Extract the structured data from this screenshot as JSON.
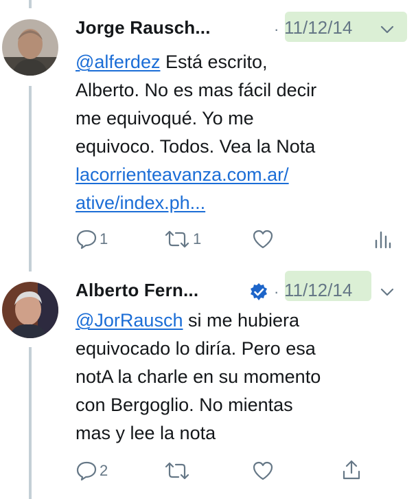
{
  "tweets": [
    {
      "author": "Jorge Rausch...",
      "separator": "·",
      "date": "11/12/14",
      "mention": "@alferdez",
      "text_lines": [
        "Está escrito,",
        "Alberto. No es mas fácil decir",
        "me equivoqué. Yo me",
        "equivoco. Todos. Vea la Nota"
      ],
      "link_lines": [
        "lacorrienteavanza.com.ar/",
        "ative/index.ph..."
      ],
      "reply_count": "1",
      "retweet_count": "1",
      "icons": [
        "reply-icon",
        "retweet-icon",
        "like-icon",
        "analytics-icon"
      ]
    },
    {
      "author": "Alberto Fern...",
      "verified": true,
      "separator": "·",
      "date": "11/12/14",
      "mention": "@JorRausch",
      "text_lines": [
        "si me hubiera",
        "equivocado lo diría. Pero esa",
        "notA la charle en su momento",
        "con Bergoglio. No mientas",
        "mas y lee la nota"
      ],
      "reply_count": "2",
      "icons": [
        "reply-icon",
        "retweet-icon",
        "like-icon",
        "share-icon"
      ]
    }
  ],
  "colors": {
    "highlight": "#cfe9c7",
    "link": "#1b6dd6",
    "verified": "#1da1f2",
    "muted": "#657786"
  }
}
